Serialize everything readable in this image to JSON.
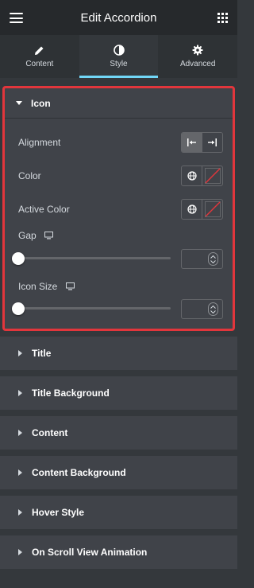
{
  "header": {
    "title": "Edit Accordion",
    "menu_icon": "hamburger-icon",
    "apps_icon": "grid-icon"
  },
  "tabs": [
    {
      "label": "Content",
      "icon": "pencil-icon",
      "active": false
    },
    {
      "label": "Style",
      "icon": "contrast-icon",
      "active": true
    },
    {
      "label": "Advanced",
      "icon": "gear-icon",
      "active": false
    }
  ],
  "icon_section": {
    "title": "Icon",
    "alignment": {
      "label": "Alignment",
      "options": [
        "align-left",
        "align-right"
      ],
      "selected": "align-left"
    },
    "color": {
      "label": "Color"
    },
    "active_color": {
      "label": "Active Color"
    },
    "gap": {
      "label": "Gap",
      "value": ""
    },
    "icon_size": {
      "label": "Icon Size",
      "value": ""
    }
  },
  "sections": [
    {
      "label": "Title"
    },
    {
      "label": "Title Background"
    },
    {
      "label": "Content"
    },
    {
      "label": "Content Background"
    },
    {
      "label": "Hover Style"
    },
    {
      "label": "On Scroll View Animation"
    }
  ],
  "colors": {
    "accent": "#71d7f7",
    "highlight_border": "#e2363c",
    "panel_bg": "#404349",
    "header_bg": "#26292c"
  }
}
